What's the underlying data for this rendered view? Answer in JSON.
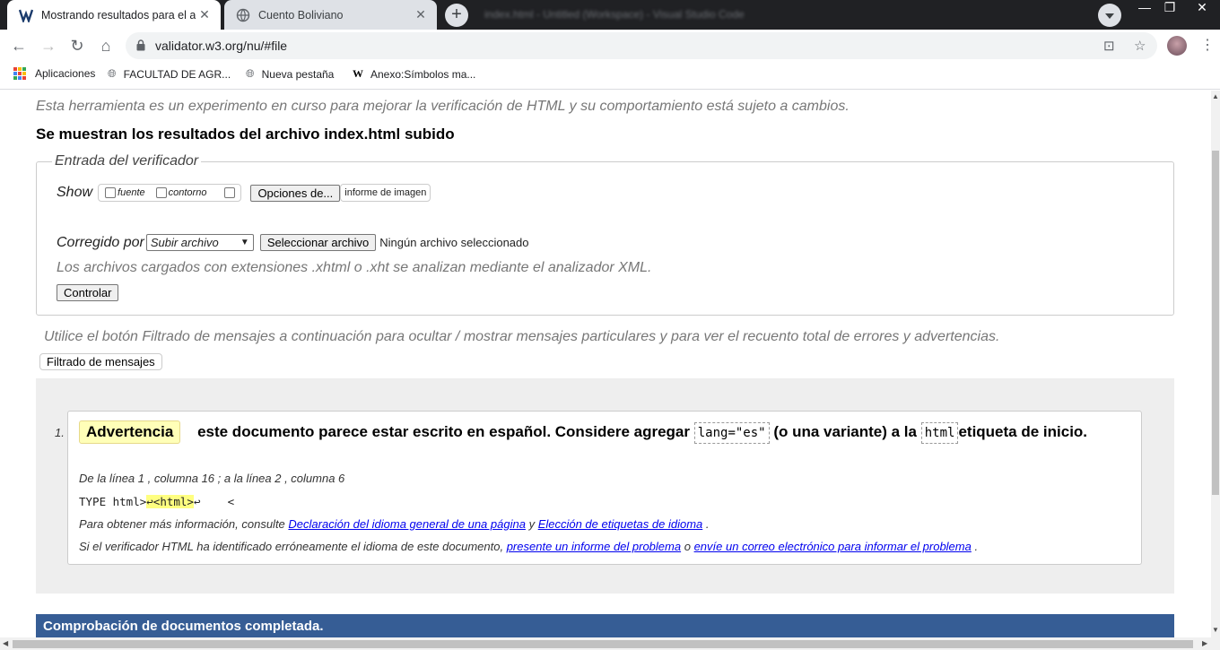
{
  "browser": {
    "tabs": [
      {
        "title": "Mostrando resultados para el archivo",
        "active": true,
        "favicon": "w3c-validator-icon"
      },
      {
        "title": "Cuento Boliviano",
        "active": false,
        "favicon": "globe-icon"
      }
    ],
    "blurred_window_title": "index.html - Untitled (Workspace) - Visual Studio Code",
    "url": "validator.w3.org/nu/#file",
    "bookmarks": [
      {
        "label": "Aplicaciones",
        "icon": "apps-icon"
      },
      {
        "label": "FACULTAD DE AGR...",
        "icon": "globe-icon"
      },
      {
        "label": "Nueva pestaña",
        "icon": "globe-icon"
      },
      {
        "label": "Anexo:Símbolos ma...",
        "icon": "wikipedia-icon"
      }
    ]
  },
  "page": {
    "intro": "Esta herramienta es un experimento en curso para mejorar la verificación de HTML y su comportamiento está sujeto a cambios.",
    "heading": "Se muestran los resultados del archivo index.html subido",
    "checker": {
      "legend": "Entrada del verificador",
      "show_label": "Show",
      "options": [
        "fuente",
        "contorno"
      ],
      "options_button": "Opciones de...",
      "image_report": "informe de imagen",
      "checked_by_label": "Corregido por",
      "select_value": "Subir archivo",
      "file_button": "Seleccionar archivo",
      "no_file": "Ningún archivo seleccionado",
      "ext_note": "Los archivos cargados con extensiones .xhtml o .xht se analizan mediante el analizador XML.",
      "control_button": "Controlar"
    },
    "filter_info": "Utilice el botón Filtrado de mensajes a continuación para ocultar / mostrar mensajes particulares y para ver el recuento total de errores y advertencias.",
    "filter_button": "Filtrado de mensajes",
    "messages": [
      {
        "number": "1.",
        "type": "Advertencia",
        "text_before": "este documento parece estar escrito en español. Considere agregar",
        "code1": "lang=\"es\"",
        "text_middle": "(o una variante) a la",
        "code2": "html",
        "text_after": "etiqueta de inicio.",
        "location": "De la línea 1 , columna 16 ; a la línea 2 , columna 6",
        "extract_pre": "TYPE html>",
        "extract_hl": "↩<html>",
        "extract_post": "↩    <",
        "info_pre": "Para obtener más información, consulte",
        "info_link1": "Declaración del idioma general de una página",
        "info_mid": "y",
        "info_link2": "Elección de etiquetas de idioma",
        "info_end": ".",
        "report_pre": "Si el verificador HTML ha identificado erróneamente el idioma de este documento,",
        "report_link1": "presente un informe del problema",
        "report_mid": "o",
        "report_link2": "envíe un correo electrónico para informar el problema",
        "report_end": "."
      }
    ],
    "done": "Comprobación de documentos completada."
  }
}
